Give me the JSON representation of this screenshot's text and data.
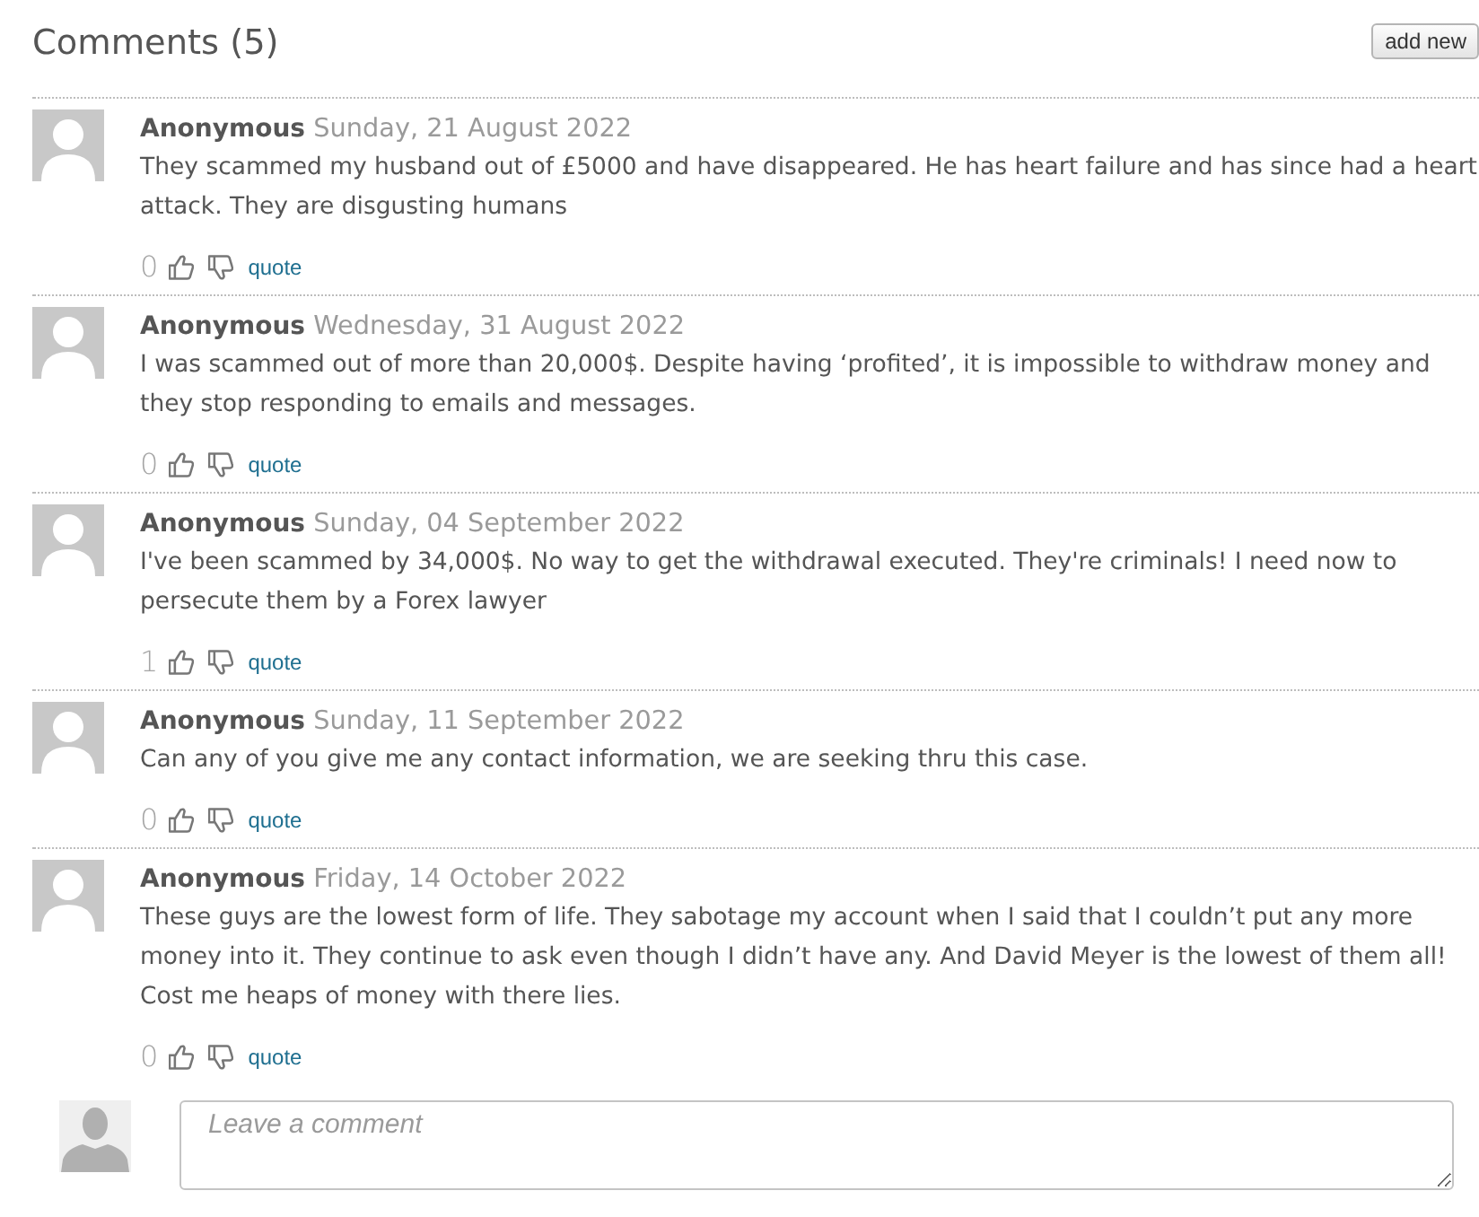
{
  "header": {
    "title": "Comments (5)",
    "add_button": "add new"
  },
  "comments": [
    {
      "author": "Anonymous",
      "date": "Sunday, 21 August 2022",
      "text": "They scammed my husband out of £5000 and have disappeared. He has heart failure and has since had a heart attack. They are disgusting humans",
      "votes": "0",
      "quote_link": "quote"
    },
    {
      "author": "Anonymous",
      "date": "Wednesday, 31 August 2022",
      "text": "I was scammed out of more than 20,000$. Despite having ‘profited’, it is impossible to withdraw money and they stop responding to emails and messages.",
      "votes": "0",
      "quote_link": "quote"
    },
    {
      "author": "Anonymous",
      "date": "Sunday, 04 September 2022",
      "text": "I've been scammed by 34,000$. No way to get the withdrawal executed. They're criminals! I need now to persecute them by a Forex lawyer",
      "votes": "1",
      "quote_link": "quote"
    },
    {
      "author": "Anonymous",
      "date": "Sunday, 11 September 2022",
      "text": "Can any of you give me any contact information, we are seeking thru this case.",
      "votes": "0",
      "quote_link": "quote"
    },
    {
      "author": "Anonymous",
      "date": "Friday, 14 October 2022",
      "text": "These guys are the lowest form of life. They sabotage my account when I said that I couldn’t put any more money into it. They continue to ask even though I didn’t have any. And David Meyer is the lowest of them all! Cost me heaps of money with there lies.",
      "votes": "0",
      "quote_link": "quote"
    }
  ],
  "compose": {
    "placeholder": "Leave a comment"
  }
}
